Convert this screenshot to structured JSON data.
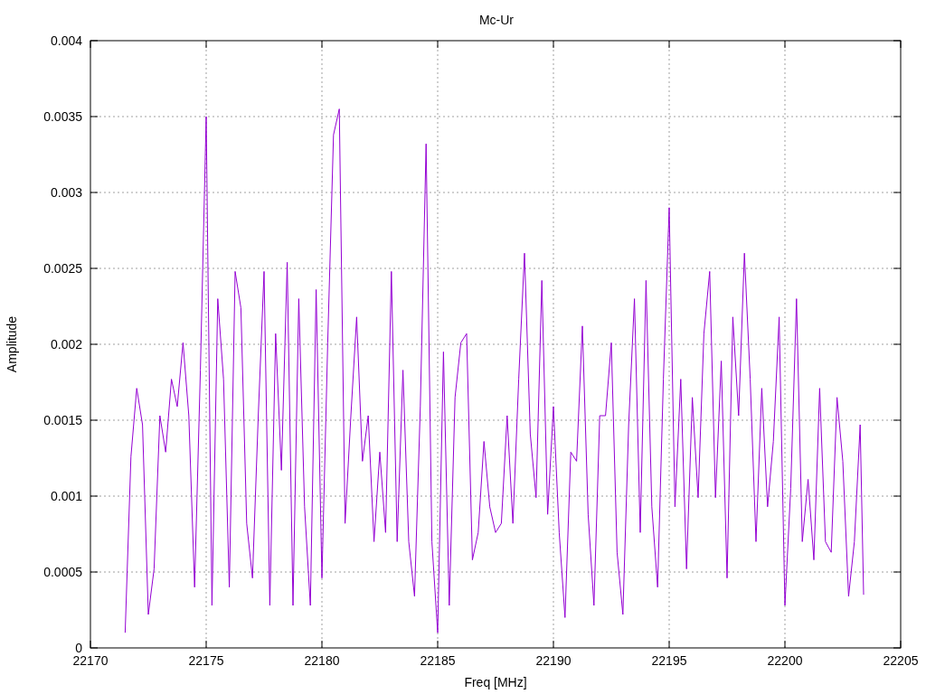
{
  "chart_data": {
    "type": "line",
    "grid": true,
    "title": "Mc-Ur",
    "xlabel": "Freq [MHz]",
    "ylabel": "Amplitude",
    "xlim": [
      22170,
      22205
    ],
    "ylim": [
      0,
      0.004
    ],
    "xticks": [
      22170,
      22175,
      22180,
      22185,
      22190,
      22195,
      22200,
      22205
    ],
    "yticks": [
      0,
      0.0005,
      0.001,
      0.0015,
      0.002,
      0.0025,
      0.003,
      0.0035,
      0.004
    ],
    "x": [
      22171.5,
      22171.75,
      22172,
      22172.25,
      22172.5,
      22172.75,
      22173,
      22173.25,
      22173.5,
      22173.75,
      22174,
      22174.25,
      22174.5,
      22174.75,
      22175,
      22175.25,
      22175.5,
      22175.75,
      22176,
      22176.25,
      22176.5,
      22176.75,
      22177,
      22177.25,
      22177.5,
      22177.75,
      22178,
      22178.25,
      22178.5,
      22178.75,
      22179,
      22179.25,
      22179.5,
      22179.75,
      22180,
      22180.25,
      22180.5,
      22180.75,
      22181,
      22181.25,
      22181.5,
      22181.75,
      22182,
      22182.25,
      22182.5,
      22182.75,
      22183,
      22183.25,
      22183.5,
      22183.75,
      22184,
      22184.25,
      22184.5,
      22184.75,
      22185,
      22185.25,
      22185.5,
      22185.75,
      22186,
      22186.25,
      22186.5,
      22186.75,
      22187,
      22187.25,
      22187.5,
      22187.75,
      22188,
      22188.25,
      22188.5,
      22188.75,
      22189,
      22189.25,
      22189.5,
      22189.75,
      22190,
      22190.25,
      22190.5,
      22190.75,
      22191,
      22191.25,
      22191.5,
      22191.75,
      22192,
      22192.25,
      22192.5,
      22192.75,
      22193,
      22193.25,
      22193.5,
      22193.75,
      22194,
      22194.25,
      22194.5,
      22194.75,
      22195,
      22195.25,
      22195.5,
      22195.75,
      22196,
      22196.25,
      22196.5,
      22196.75,
      22197,
      22197.25,
      22197.5,
      22197.75,
      22198,
      22198.25,
      22198.5,
      22198.75,
      22199,
      22199.25,
      22199.5,
      22199.75,
      22200,
      22200.25,
      22200.5,
      22200.75,
      22201,
      22201.25,
      22201.5,
      22201.75,
      22202,
      22202.25,
      22202.5,
      22202.75,
      22203,
      22203.25,
      22203.4
    ],
    "series": [
      {
        "color": "#9400d3",
        "values": [
          0.0001,
          0.00126,
          0.00171,
          0.00147,
          0.00022,
          0.00052,
          0.00153,
          0.00129,
          0.00177,
          0.00159,
          0.00201,
          0.00153,
          0.0004,
          0.00183,
          0.0035,
          0.00028,
          0.0023,
          0.00177,
          0.0004,
          0.00248,
          0.00224,
          0.00082,
          0.00046,
          0.00153,
          0.00248,
          0.00028,
          0.00207,
          0.00117,
          0.00254,
          0.00028,
          0.0023,
          0.00093,
          0.00028,
          0.00236,
          0.00046,
          0.00201,
          0.00338,
          0.00355,
          0.00082,
          0.00153,
          0.00218,
          0.00123,
          0.00153,
          0.0007,
          0.00129,
          0.00076,
          0.00248,
          0.0007,
          0.00183,
          0.0007,
          0.00034,
          0.00159,
          0.00332,
          0.0007,
          0.0001,
          0.00195,
          0.00028,
          0.00165,
          0.00201,
          0.00207,
          0.00058,
          0.00076,
          0.00136,
          0.00093,
          0.00076,
          0.00082,
          0.00153,
          0.00082,
          0.00177,
          0.0026,
          0.00141,
          0.00099,
          0.00242,
          0.00088,
          0.00159,
          0.00076,
          0.0002,
          0.00129,
          0.00123,
          0.00212,
          0.00088,
          0.00028,
          0.00153,
          0.00153,
          0.00201,
          0.00063,
          0.00022,
          0.00147,
          0.0023,
          0.00076,
          0.00242,
          0.00093,
          0.0004,
          0.00177,
          0.0029,
          0.00093,
          0.00177,
          0.00052,
          0.00165,
          0.00099,
          0.00207,
          0.00248,
          0.00099,
          0.00189,
          0.00046,
          0.00218,
          0.00153,
          0.0026,
          0.00177,
          0.0007,
          0.00171,
          0.00093,
          0.00136,
          0.00218,
          0.00028,
          0.00105,
          0.0023,
          0.0007,
          0.00111,
          0.00058,
          0.00171,
          0.0007,
          0.00063,
          0.00165,
          0.00123,
          0.00034,
          0.0007,
          0.00147,
          0.00035
        ]
      }
    ]
  }
}
